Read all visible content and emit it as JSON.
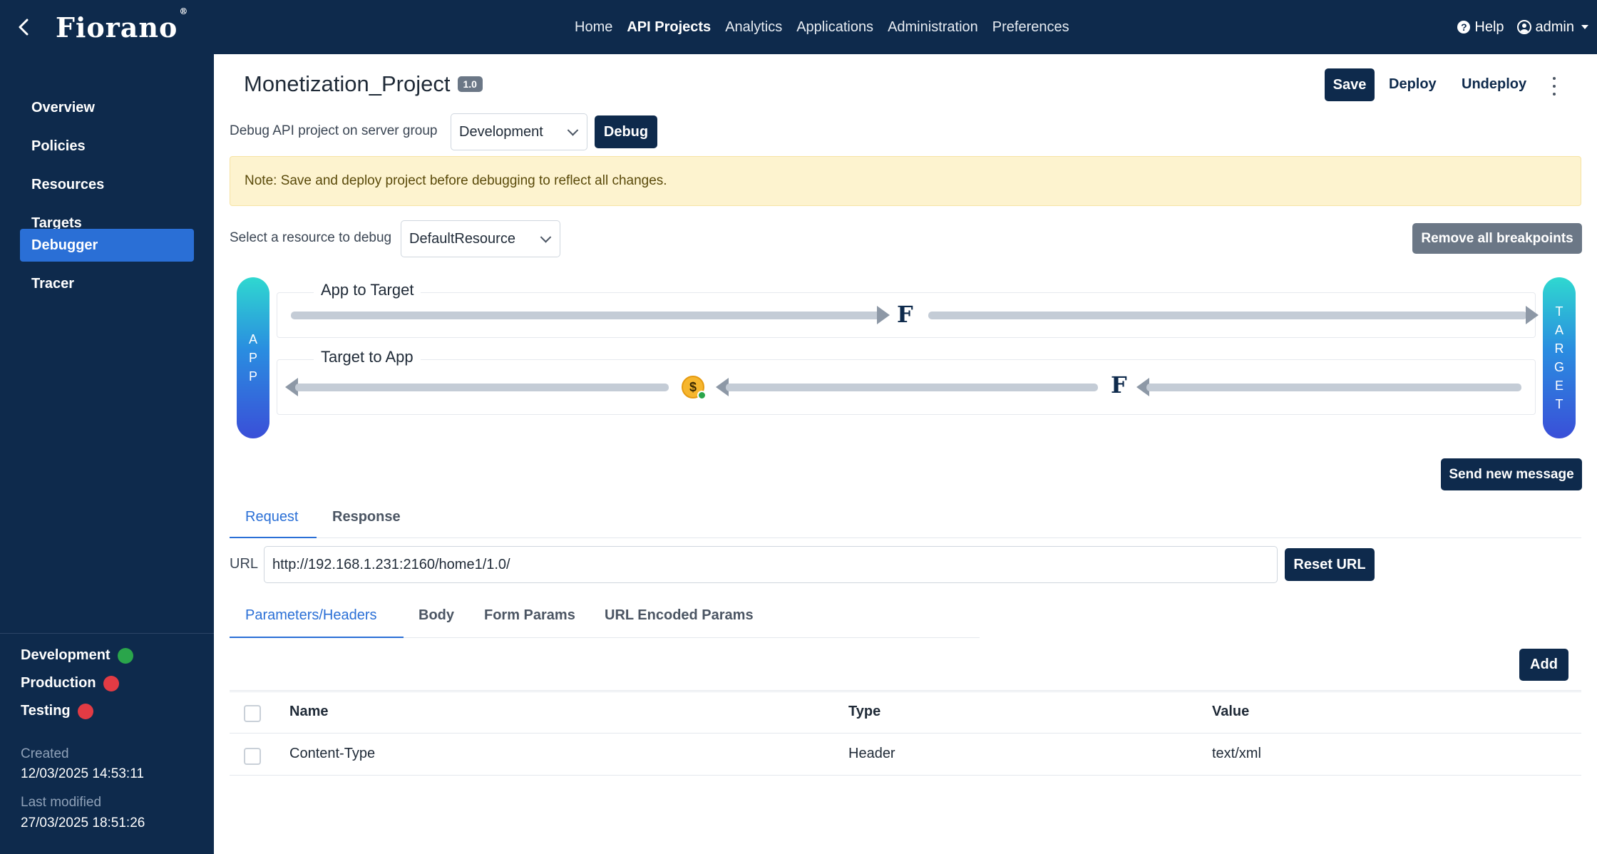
{
  "navbar": {
    "brand": "Fiorano",
    "brand_mark": "®",
    "items": [
      "Home",
      "API Projects",
      "Analytics",
      "Applications",
      "Administration",
      "Preferences"
    ],
    "active_index": 1,
    "help_label": "Help",
    "help_glyph": "?",
    "user_label": "admin"
  },
  "sidebar": {
    "items": [
      "Overview",
      "Policies",
      "Resources",
      "Targets",
      "Debugger",
      "Tracer"
    ],
    "active_index": 4,
    "environments": [
      {
        "name": "Development",
        "status_color": "#2aa54b"
      },
      {
        "name": "Production",
        "status_color": "#e23b44"
      },
      {
        "name": "Testing",
        "status_color": "#e23b44"
      }
    ],
    "created_label": "Created",
    "created_value": "12/03/2025 14:53:11",
    "modified_label": "Last modified",
    "modified_value": "27/03/2025 18:51:26"
  },
  "project": {
    "name": "Monetization_Project",
    "version": "1.0"
  },
  "actions": {
    "save": "Save",
    "deploy": "Deploy",
    "undeploy": "Undeploy"
  },
  "debug": {
    "server_group_label": "Debug API project on server group",
    "server_group_value": "Development",
    "debug_button": "Debug",
    "note": "Note: Save and deploy project before debugging to reflect all changes.",
    "resource_label": "Select a resource to debug",
    "resource_value": "DefaultResource",
    "remove_breakpoints": "Remove all breakpoints",
    "send_new_message": "Send new message"
  },
  "flow": {
    "app_letters": [
      "A",
      "P",
      "P"
    ],
    "target_letters": [
      "T",
      "A",
      "R",
      "G",
      "E",
      "T"
    ],
    "app_to_target_title": "App to Target",
    "target_to_app_title": "Target to App",
    "policy_glyph": "F",
    "monetization_glyph": "$"
  },
  "tabs": {
    "request": "Request",
    "response": "Response"
  },
  "url": {
    "label": "URL",
    "value": "http://192.168.1.231:2160/home1/1.0/",
    "reset_button": "Reset URL"
  },
  "subtabs": [
    "Parameters/Headers",
    "Body",
    "Form Params",
    "URL Encoded Params"
  ],
  "params": {
    "add_button": "Add",
    "columns": [
      "Name",
      "Type",
      "Value"
    ],
    "rows": [
      {
        "name": "Content-Type",
        "type": "Header",
        "value": "text/xml"
      }
    ]
  },
  "colors": {
    "navy": "#0e2a4c",
    "accent": "#2a6fd6",
    "note_bg": "#fdf3cf"
  }
}
